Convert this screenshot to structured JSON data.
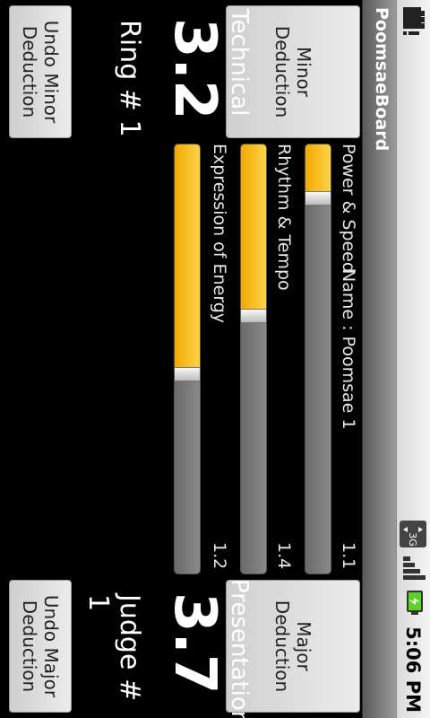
{
  "status_bar": {
    "left_icon": "notification-alert-icon",
    "network": "3G",
    "signal_icon": "signal-icon",
    "battery_icon": "battery-charging-icon",
    "time": "5:06 PM"
  },
  "app": {
    "title": "PoomsaeBoard"
  },
  "buttons": {
    "minor": "Minor\nDeduction",
    "major": "Major\nDeduction",
    "undo_minor": "Undo Minor\nDeduction",
    "undo_major": "Undo Major\nDeduction"
  },
  "name_label": "Name : Poomsae 1",
  "sliders": [
    {
      "label": "Power & Speed",
      "value": "1.1",
      "fraction": 0.125
    },
    {
      "label": "Rhythm & Tempo",
      "value": "1.4",
      "fraction": 0.4
    },
    {
      "label": "Expression of Energy",
      "value": "1.2",
      "fraction": 0.535
    }
  ],
  "technical": {
    "label": "Technical",
    "score": "3.2",
    "ring": "Ring # 1"
  },
  "presentation": {
    "label": "Presentation",
    "score": "3.7",
    "judge": "Judge # 1"
  },
  "colors": {
    "accent_fill": "#f0aa00",
    "track": "#7a7a7a",
    "title_bar": "#7a7a7a"
  }
}
